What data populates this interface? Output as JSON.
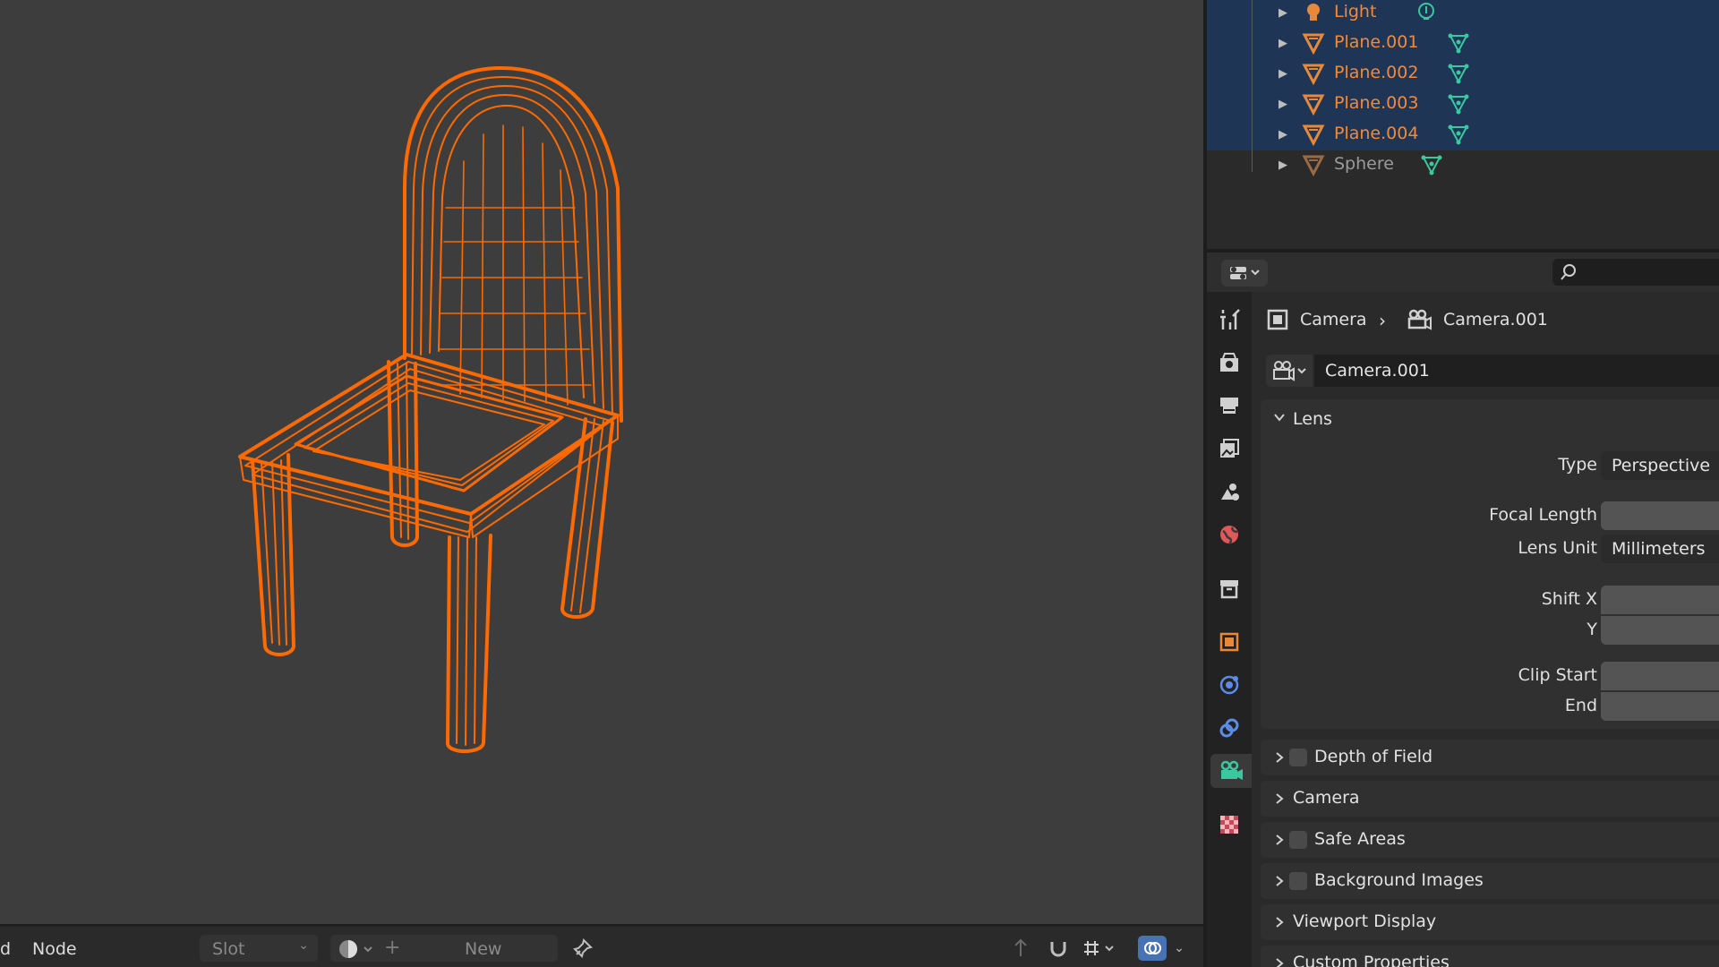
{
  "outliner": {
    "items": [
      {
        "label": "Light",
        "color": "#f28a3a",
        "icon": "light-icon",
        "data_icon": "light-data-icon",
        "selected": true
      },
      {
        "label": "Plane.001",
        "color": "#f28a3a",
        "icon": "mesh-object-icon",
        "data_icon": "mesh-data-icon",
        "selected": true
      },
      {
        "label": "Plane.002",
        "color": "#f28a3a",
        "icon": "mesh-object-icon",
        "data_icon": "mesh-data-icon",
        "selected": true
      },
      {
        "label": "Plane.003",
        "color": "#f28a3a",
        "icon": "mesh-object-icon",
        "data_icon": "mesh-data-icon",
        "selected": true
      },
      {
        "label": "Plane.004",
        "color": "#f28a3a",
        "icon": "mesh-object-icon",
        "data_icon": "mesh-data-icon",
        "selected": true
      },
      {
        "label": "Sphere",
        "color": "#9a9a9a",
        "icon": "mesh-object-icon",
        "data_icon": "mesh-data-icon",
        "selected": false
      }
    ]
  },
  "properties": {
    "search_placeholder": "",
    "breadcrumb": {
      "object": "Camera",
      "data": "Camera.001"
    },
    "datablock_name": "Camera.001",
    "lens": {
      "title": "Lens",
      "type_label": "Type",
      "type_value": "Perspective",
      "focal_length_label": "Focal Length",
      "focal_length_value": "",
      "lens_unit_label": "Lens Unit",
      "lens_unit_value": "Millimeters",
      "shift_x_label": "Shift X",
      "shift_x_value": "",
      "shift_y_label": "Y",
      "shift_y_value": "",
      "clip_start_label": "Clip Start",
      "clip_start_value": "",
      "clip_end_label": "End",
      "clip_end_value": ""
    },
    "collapsed_panels": [
      {
        "label": "Depth of Field",
        "checkbox": true
      },
      {
        "label": "Camera",
        "checkbox": false
      },
      {
        "label": "Safe Areas",
        "checkbox": true
      },
      {
        "label": "Background Images",
        "checkbox": true
      },
      {
        "label": "Viewport Display",
        "checkbox": false
      },
      {
        "label": "Custom Properties",
        "checkbox": false
      }
    ],
    "tabs": [
      "tool",
      "render",
      "output",
      "view-layer",
      "scene",
      "world",
      "collection",
      "object",
      "modifiers",
      "physics",
      "object-data",
      "texture"
    ],
    "active_tab": "object-data"
  },
  "bottom_bar": {
    "menu_partial": "d",
    "node_label": "Node",
    "slot_label": "Slot",
    "new_label": "New"
  },
  "colors": {
    "wire_orange": "#ff6a00",
    "selection_blue": "#1e3556",
    "camera_green": "#39c8a0"
  }
}
